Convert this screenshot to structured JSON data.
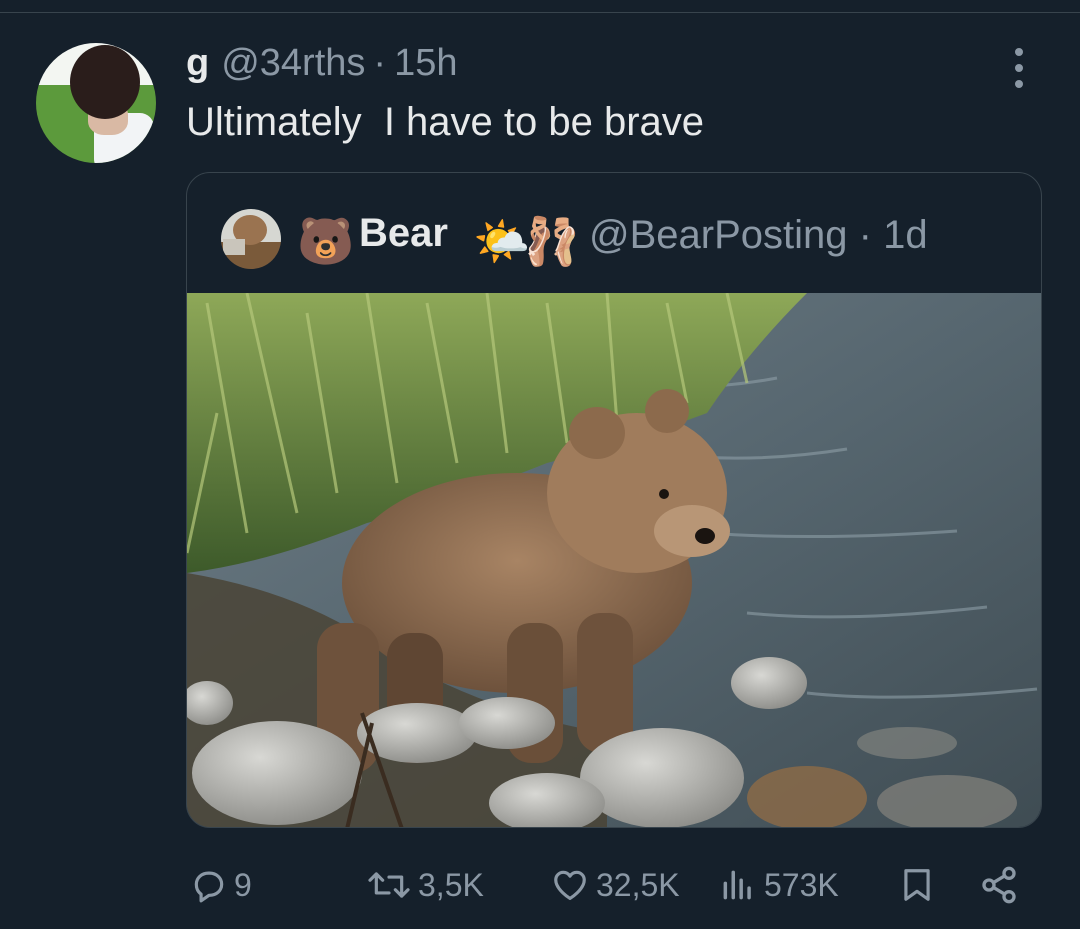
{
  "tweet": {
    "display_name": "g",
    "handle": "@34rths",
    "separator": "·",
    "time": "15h",
    "text": "Ultimately  I have to be brave",
    "menu_icon": "more-vertical-icon"
  },
  "quoted": {
    "name_prefix_emoji": "🐻",
    "name": "Bear",
    "name_suffix_emojis": [
      "🌤️",
      "🩰"
    ],
    "handle": "@BearPosting",
    "separator": "·",
    "time": "1d",
    "media_description_icon": "photo-brown-bear-cub-by-river"
  },
  "actions": {
    "replies": "9",
    "reposts": "3,5K",
    "likes": "32,5K",
    "views": "573K"
  },
  "colors": {
    "background": "#15202b",
    "primary_text": "#e7e9ea",
    "secondary_text": "#8b98a5",
    "border": "#38444d"
  }
}
